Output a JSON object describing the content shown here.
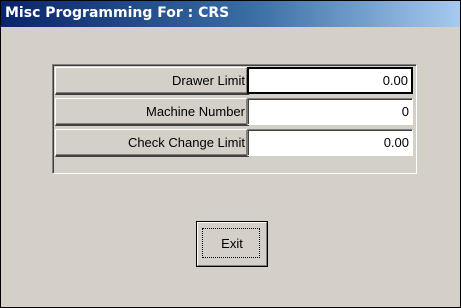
{
  "window": {
    "title": "Misc Programming For :  CRS"
  },
  "fields": [
    {
      "label": "Drawer Limit",
      "value": "0.00"
    },
    {
      "label": "Machine Number",
      "value": "0"
    },
    {
      "label": "Check Change Limit",
      "value": "0.00"
    }
  ],
  "buttons": {
    "exit_label": "Exit"
  },
  "colors": {
    "titlebar_start": "#0a246a",
    "titlebar_end": "#a6caf0",
    "face": "#d4d0c8"
  }
}
